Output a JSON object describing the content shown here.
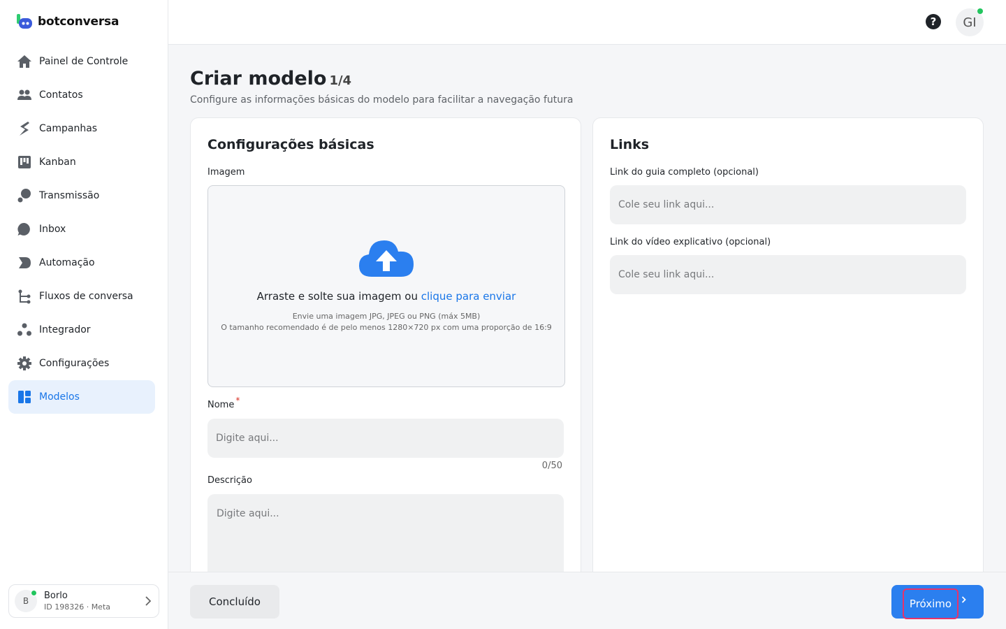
{
  "brand": {
    "name": "botconversa"
  },
  "sidebar": {
    "items": [
      {
        "label": "Painel de Controle",
        "icon": "home-icon"
      },
      {
        "label": "Contatos",
        "icon": "contacts-icon"
      },
      {
        "label": "Campanhas",
        "icon": "campaigns-icon"
      },
      {
        "label": "Kanban",
        "icon": "kanban-icon"
      },
      {
        "label": "Transmissão",
        "icon": "broadcast-icon"
      },
      {
        "label": "Inbox",
        "icon": "chat-bubble-icon"
      },
      {
        "label": "Automação",
        "icon": "automation-icon"
      },
      {
        "label": "Fluxos de conversa",
        "icon": "flows-icon"
      },
      {
        "label": "Integrador",
        "icon": "integrator-icon"
      },
      {
        "label": "Configurações",
        "icon": "gear-icon"
      },
      {
        "label": "Modelos",
        "icon": "templates-icon",
        "active": true
      }
    ],
    "account": {
      "initial": "B",
      "name": "Borlo",
      "id_line": "ID 198326 · Meta"
    }
  },
  "topbar": {
    "help_symbol": "?",
    "user_initials": "GI"
  },
  "header": {
    "title": "Criar modelo",
    "step": "1/4",
    "subtitle": "Configure as informações básicas do modelo para facilitar a navegação futura"
  },
  "basic": {
    "title": "Configurações básicas",
    "image_label": "Imagem",
    "upload_text": "Arraste e solte sua imagem ou",
    "upload_link": "clique para enviar",
    "upload_hint1": "Envie uma imagem JPG, JPEG ou PNG (máx 5MB)",
    "upload_hint2": "O tamanho recomendado é de pelo menos 1280×720 px com uma proporção de 16:9",
    "name_label": "Nome",
    "required_mark": "*",
    "name_placeholder": "Digite aqui...",
    "name_counter": "0/50",
    "desc_label": "Descrição",
    "desc_placeholder": "Digite aqui..."
  },
  "links": {
    "title": "Links",
    "guide_label": "Link do guia completo (opcional)",
    "guide_placeholder": "Cole seu link aqui...",
    "video_label": "Link do vídeo explicativo (opcional)",
    "video_placeholder": "Cole seu link aqui..."
  },
  "footer": {
    "done_label": "Concluído",
    "next_label": "Próximo"
  },
  "colors": {
    "accent": "#2b7fef",
    "active_bg": "#e8f1fd",
    "online": "#22c55e",
    "highlight": "#e8336a"
  }
}
